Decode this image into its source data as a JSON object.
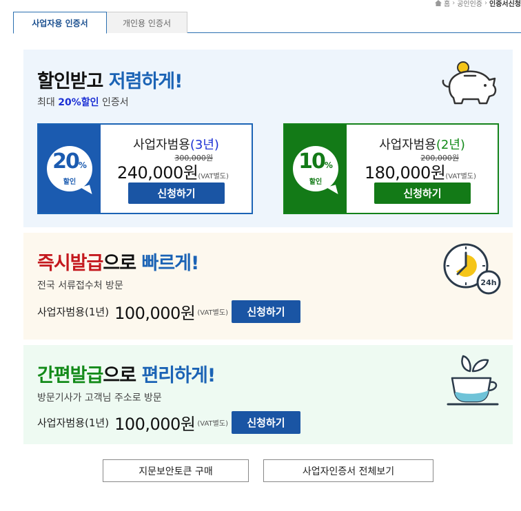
{
  "breadcrumb": {
    "home_label": "홈",
    "level1": "공인인증",
    "current": "인증서신청"
  },
  "tabs": [
    {
      "label": "사업자용 인증서",
      "active": true
    },
    {
      "label": "개인용 인증서",
      "active": false
    }
  ],
  "discount_panel": {
    "headline_black": "할인받고",
    "headline_blue": "저렴하게!",
    "subtitle_prefix": "최대",
    "subtitle_highlight": "20%할인",
    "subtitle_suffix": "인증서",
    "icon": "piggy-bank-icon",
    "cards": [
      {
        "discount_number": "20",
        "discount_pct": "%",
        "discount_label": "할인",
        "product_name": "사업자범용",
        "product_term": "(3년)",
        "original_price": "300,000원",
        "price": "240,000원",
        "vat": "(VAT별도)",
        "button_label": "신청하기",
        "accent_color": "#1b5bb0"
      },
      {
        "discount_number": "10",
        "discount_pct": "%",
        "discount_label": "할인",
        "product_name": "사업자범용",
        "product_term": "(2년)",
        "original_price": "200,000원",
        "price": "180,000원",
        "vat": "(VAT별도)",
        "button_label": "신청하기",
        "accent_color": "#137a17"
      }
    ]
  },
  "instant_panel": {
    "headline_red": "즉시발급",
    "headline_black": "으로",
    "headline_blue": "빠르게!",
    "subtitle": "전국 서류접수처 방문",
    "product": "사업자범용(1년)",
    "price": "100,000원",
    "vat": "(VAT별도)",
    "button_label": "신청하기",
    "icon": "clock-24h-icon",
    "icon_badge": "24h"
  },
  "easy_panel": {
    "headline_green": "간편발급",
    "headline_black": "으로",
    "headline_blue": "편리하게!",
    "subtitle": "방문기사가 고객님 주소로 방문",
    "product": "사업자범용(1년)",
    "price": "100,000원",
    "vat": "(VAT별도)",
    "button_label": "신청하기",
    "icon": "tea-cup-icon"
  },
  "bottom_buttons": {
    "token_label": "지문보안토큰 구매",
    "view_all_label": "사업자인증서 전체보기"
  },
  "colors": {
    "blue": "#1b63b5",
    "red": "#c4191e",
    "green": "#138a19",
    "button_blue": "#1a55a4"
  }
}
